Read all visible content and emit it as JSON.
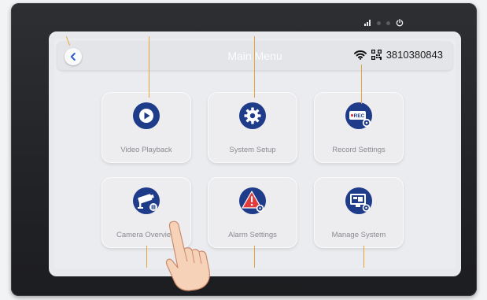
{
  "device": {
    "indicators": [
      "signal-icon",
      "led-dot",
      "led-dot",
      "power-icon"
    ]
  },
  "header": {
    "title": "Main Menu",
    "back_icon": "chevron-left-icon",
    "wifi_icon": "wifi-icon",
    "qr_icon": "qr-code-icon",
    "device_id": "3810380843"
  },
  "menu": {
    "items": [
      {
        "label": "Video Playback",
        "icon": "play-icon"
      },
      {
        "label": "System Setup",
        "icon": "gear-icon"
      },
      {
        "label": "Record Settings",
        "icon": "rec-settings-icon",
        "badge": "REC"
      },
      {
        "label": "Camera Overview",
        "icon": "camera-settings-icon"
      },
      {
        "label": "Alarm Settings",
        "icon": "alarm-settings-icon"
      },
      {
        "label": "Manage System",
        "icon": "manage-system-icon"
      }
    ]
  },
  "colors": {
    "icon_bg": "#1f3c8a",
    "alarm_bg": "#e23b3b",
    "callout": "#e8a33a",
    "accent": "#3a78f0"
  }
}
